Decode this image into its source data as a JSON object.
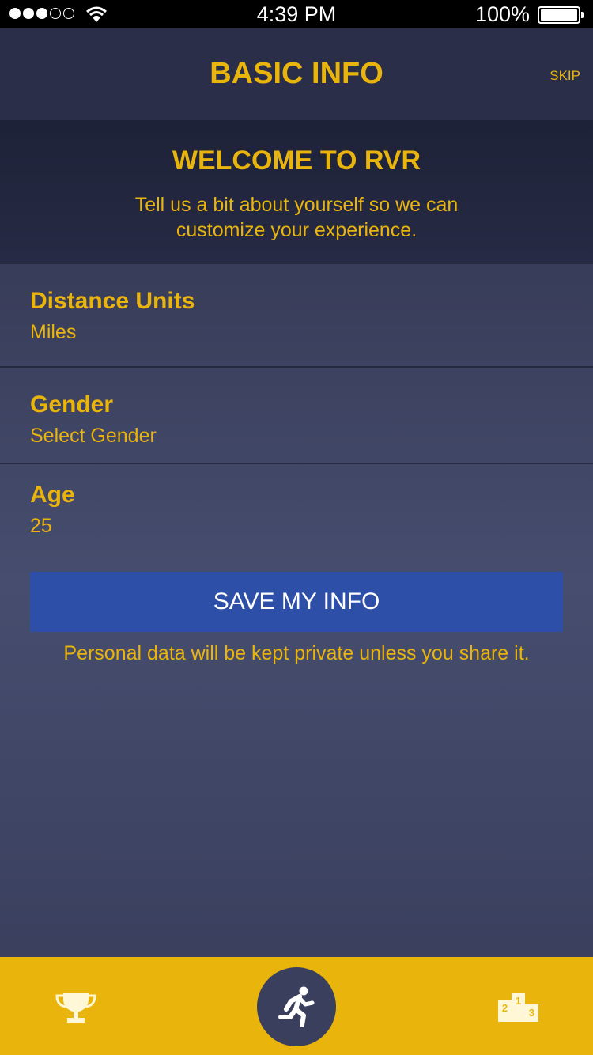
{
  "status_bar": {
    "time": "4:39 PM",
    "battery": "100%",
    "signal_dots_filled": 3,
    "signal_dots_total": 5
  },
  "header": {
    "title": "BASIC INFO",
    "skip_label": "SKIP"
  },
  "welcome": {
    "title": "WELCOME TO RVR",
    "text": "Tell us a bit about yourself so we can customize your experience."
  },
  "fields": [
    {
      "label": "Distance Units",
      "value": "Miles"
    },
    {
      "label": "Gender",
      "value": "Select Gender"
    },
    {
      "label": "Age",
      "value": "25"
    }
  ],
  "save_button_label": "SAVE MY INFO",
  "privacy_note": "Personal data will be kept private unless you share it.",
  "tabbar": {
    "items": [
      {
        "icon": "trophy-icon"
      },
      {
        "icon": "run-icon",
        "active": true
      },
      {
        "icon": "podium-icon"
      }
    ],
    "podium_numbers": [
      "2",
      "1",
      "3"
    ]
  },
  "colors": {
    "accent": "#e9b40c",
    "button": "#2e4fa8",
    "header_bg": "#2a2e48",
    "tabbar_bg": "#e9b40c"
  }
}
